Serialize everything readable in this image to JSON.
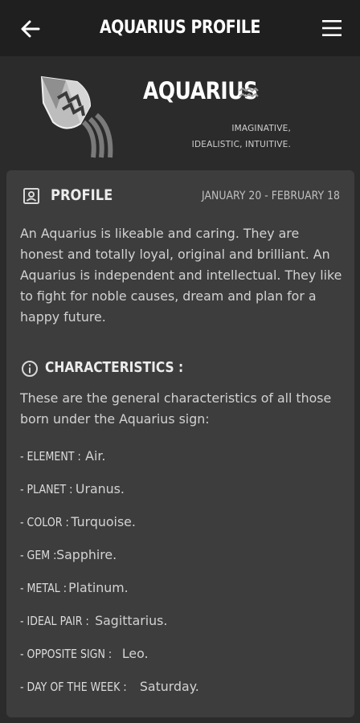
{
  "appbar": {
    "title": "AQUARIUS PROFILE",
    "back_icon": "arrow-left-icon",
    "menu_icon": "hamburger-menu-icon"
  },
  "hero": {
    "sign_name": "AQUARIUS",
    "glyph_icon": "aquarius-glyph-icon",
    "art_icon": "aquarius-water-jug-icon",
    "traits_line1": "IMAGINATIVE,",
    "traits_line2": "IDEALISTIC, INTUITIVE."
  },
  "profile": {
    "title": "PROFILE",
    "dates": "JANUARY 20 - FEBRUARY 18",
    "text": "An Aquarius is likeable and caring. They are honest and totally loyal, original and brilliant. An Aquarius is independent and intellectual. They like to fight for noble causes, dream and plan for a happy future."
  },
  "characteristics": {
    "title": "CHARACTERISTICS :",
    "intro": "These are the general characteristics of all those born under the Aquarius sign:",
    "facts": [
      {
        "key": "- ELEMENT :",
        "value": "Air."
      },
      {
        "key": "- PLANET :",
        "value": "Uranus."
      },
      {
        "key": "- COLOR :",
        "value": "Turquoise."
      },
      {
        "key": "- GEM :",
        "value": "Sapphire."
      },
      {
        "key": "- METAL :",
        "value": "Platinum."
      },
      {
        "key": "- IDEAL PAIR :",
        "value": "Sagittarius."
      },
      {
        "key": "- OPPOSITE SIGN :",
        "value": "Leo."
      },
      {
        "key": "- DAY OF THE WEEK :",
        "value": "Saturday."
      }
    ]
  },
  "colors": {
    "appbar_bg": "#1f1f1f",
    "page_bg": "#2b2b2b",
    "card_bg": "#3d3d3d",
    "text": "#d2d2d2",
    "title": "#ffffff"
  }
}
